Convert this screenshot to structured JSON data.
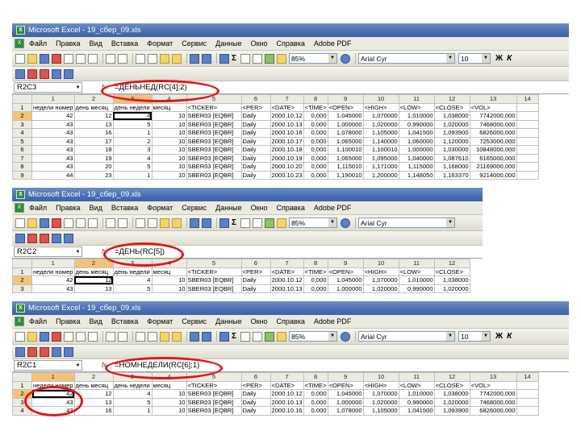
{
  "title": "Microsoft Excel - 19_сбер_09.xls",
  "menu": [
    "Файл",
    "Правка",
    "Вид",
    "Вставка",
    "Формат",
    "Сервис",
    "Данные",
    "Окно",
    "Справка",
    "Adobe PDF"
  ],
  "zoom": "85%",
  "font_name": "Arial Cyr",
  "font_size": "10",
  "bold_label": "Ж",
  "italic_label": "К",
  "col_headers": [
    "1",
    "2",
    "3",
    "4",
    "5",
    "6",
    "7",
    "8",
    "9",
    "10",
    "11",
    "12",
    "13",
    "14"
  ],
  "header_row": [
    "недели номер",
    "день месяц",
    "день недели",
    "месяц",
    "<TICKER>",
    "<PER>",
    "<DATE>",
    "<TIME>",
    "<OPEN>",
    "<HIGH>",
    "<LOW>",
    "<CLOSE>",
    "<VOL>",
    ""
  ],
  "rows": [
    [
      "42",
      "12",
      "4",
      "10",
      "SBER03 [EQBR]",
      "Daily",
      "2000.10.12",
      "0,000",
      "1,045000",
      "1,070000",
      "1,010000",
      "1,038000",
      "7742000,000",
      ""
    ],
    [
      "43",
      "13",
      "5",
      "10",
      "SBER03 [EQBR]",
      "Daily",
      "2000.10.13",
      "0,000",
      "1,000000",
      "1,020000",
      "0,990000",
      "1,020000",
      "7468000,000",
      ""
    ],
    [
      "43",
      "16",
      "1",
      "10",
      "SBER03 [EQBR]",
      "Daily",
      "2000.10.16",
      "0,000",
      "1,078000",
      "1,105000",
      "1,041500",
      "1,093900",
      "6826000,000",
      ""
    ],
    [
      "43",
      "17",
      "2",
      "10",
      "SBER03 [EQBR]",
      "Daily",
      "2000.10.17",
      "0,000",
      "1,065000",
      "1,140000",
      "1,060000",
      "1,120000",
      "7253000,000",
      ""
    ],
    [
      "43",
      "18",
      "3",
      "10",
      "SBER03 [EQBR]",
      "Daily",
      "2000.10.18",
      "0,000",
      "1,100010",
      "1,100010",
      "1,000000",
      "1,030000",
      "10848000,000",
      ""
    ],
    [
      "43",
      "19",
      "4",
      "10",
      "SBER03 [EQBR]",
      "Daily",
      "2000.10.19",
      "0,000",
      "1,065000",
      "1,095000",
      "1,040000",
      "1,087610",
      "6165000,000",
      ""
    ],
    [
      "43",
      "20",
      "5",
      "10",
      "SBER03 [EQBR]",
      "Daily",
      "2000.10.20",
      "0,000",
      "1,115010",
      "1,171000",
      "1,115000",
      "1,168000",
      "21169000,000",
      ""
    ],
    [
      "44",
      "23",
      "1",
      "10",
      "SBER03 [EQBR]",
      "Daily",
      "2000.10.23",
      "0,000",
      "1,190010",
      "1,200000",
      "1,148050",
      "1,163370",
      "9214000,000",
      ""
    ]
  ],
  "windows": [
    {
      "name_box": "R2C3",
      "formula": "=ДЕНЬНЕД(RC[4];2)"
    },
    {
      "name_box": "R2C2",
      "formula": "=ДЕНЬ(RC[5])"
    },
    {
      "name_box": "R2C1",
      "formula": "=НОМНЕДЕЛИ(RC[6];1)"
    }
  ],
  "colors": {
    "title_bar": "#4a6eaf",
    "selected_header": "#f4c37a",
    "annotation": "#e01818"
  }
}
